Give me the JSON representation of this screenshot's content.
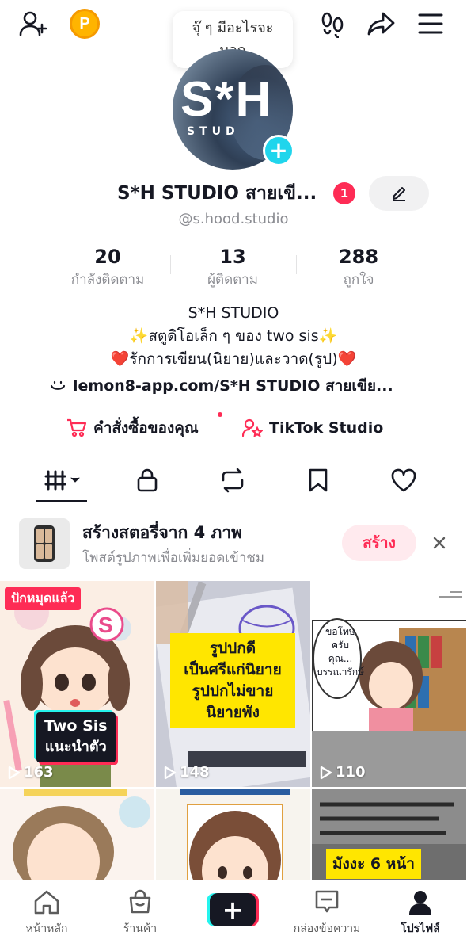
{
  "topbar": {
    "icons": [
      "add-friend-icon",
      "coin-icon",
      "footprint-icon",
      "share-icon",
      "menu-icon"
    ],
    "coin_letter": "P",
    "bubble_line1": "จุ๊ ๆ มีอะไรจะ",
    "bubble_line2": "บอก"
  },
  "avatar": {
    "text_main": "S*H",
    "text_sub": "STUD"
  },
  "profile": {
    "name": "S*H STUDIO สายเขี...",
    "notification_count": "1",
    "handle": "@s.hood.studio"
  },
  "stats": [
    {
      "value": "20",
      "label": "กำลังติดตาม"
    },
    {
      "value": "13",
      "label": "ผู้ติดตาม"
    },
    {
      "value": "288",
      "label": "ถูกใจ"
    }
  ],
  "bio": {
    "line1": "S*H STUDIO",
    "line2": "✨สตูดิโอเล็ก ๆ ของ two sis✨",
    "line3": "❤️รักการเขียน(นิยาย)และวาด(รูป)❤️",
    "link": "lemon8-app.com/S*H STUDIO สายเขีย..."
  },
  "actions": {
    "orders": "คำสั่งซื้อของคุณ",
    "studio": "TikTok Studio"
  },
  "tabs": [
    "videos-tab",
    "private-tab",
    "repost-tab",
    "saved-tab",
    "liked-tab"
  ],
  "banner": {
    "title": "สร้างสตอรี่จาก 4 ภาพ",
    "subtitle": "โพสต์รูปภาพเพื่อเพิ่มยอดเข้าชม",
    "button": "สร้าง"
  },
  "videos": [
    {
      "views": "163",
      "tag": "ปักหมุดแล้ว",
      "caption1": "Two Sis",
      "caption2": "แนะนำตัว"
    },
    {
      "views": "148",
      "text1": "รูปปกดี",
      "text2": "เป็นศรีแก่นิยาย",
      "text3": "รูปปกไม่ขาย",
      "text4": "นิยายพัง"
    },
    {
      "views": "110",
      "speech1": "ขอโทษ",
      "speech2": "ครับ",
      "speech3": "คุณ...",
      "speech4": "บรรณารักษ์"
    },
    {
      "views": ""
    },
    {
      "views": ""
    },
    {
      "views": "",
      "text1": "มังงะ 6 หน้า"
    }
  ],
  "bottomnav": [
    {
      "label": "หน้าหลัก",
      "icon": "home-icon"
    },
    {
      "label": "ร้านค้า",
      "icon": "shop-icon"
    },
    {
      "label": "",
      "icon": "create-icon"
    },
    {
      "label": "กล่องข้อความ",
      "icon": "inbox-icon"
    },
    {
      "label": "โปรไฟล์",
      "icon": "profile-icon"
    }
  ]
}
